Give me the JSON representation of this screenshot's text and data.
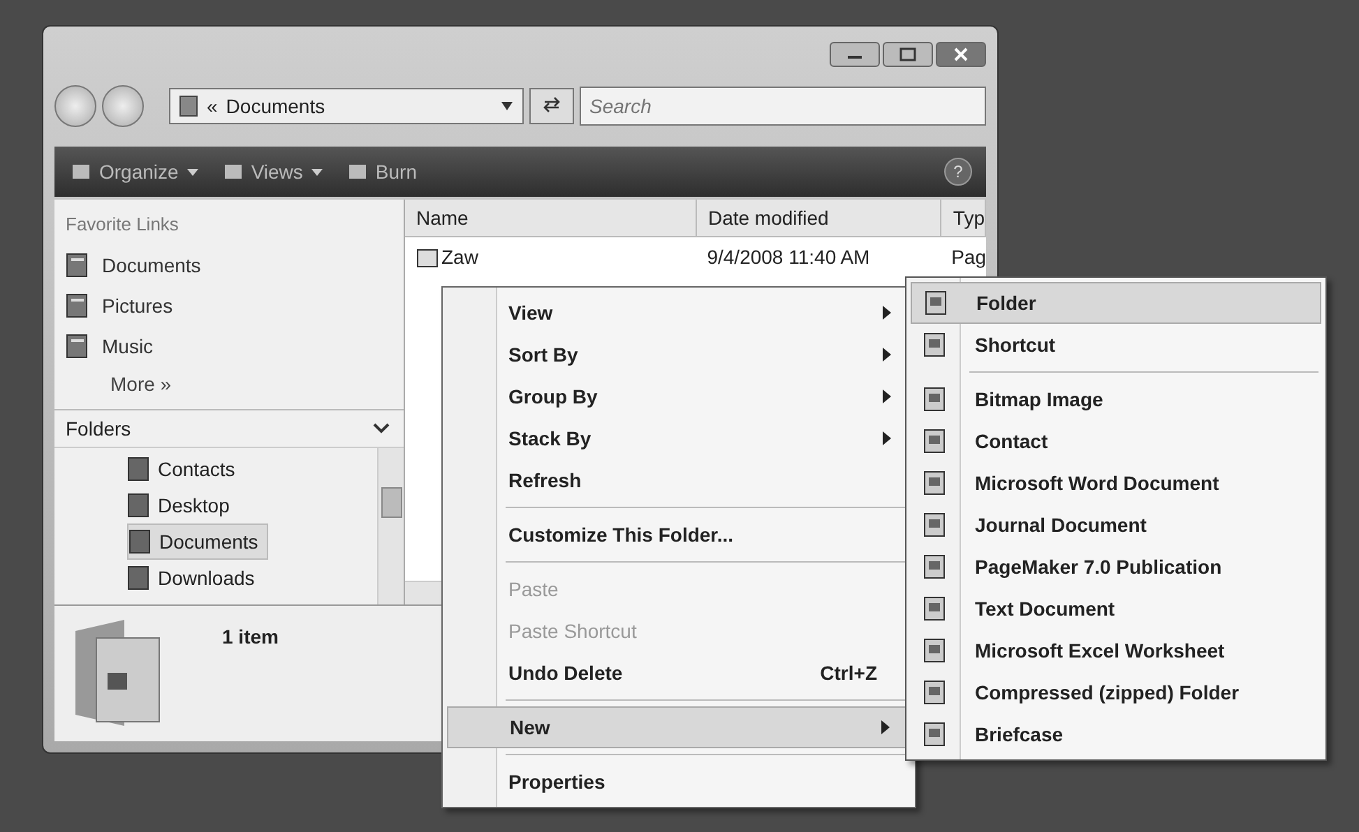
{
  "address_bar": {
    "prefix": "«",
    "location": "Documents"
  },
  "search": {
    "placeholder": "Search"
  },
  "toolbar": {
    "items": [
      {
        "label": "Organize",
        "has_menu": true
      },
      {
        "label": "Views",
        "has_menu": true
      },
      {
        "label": "Burn",
        "has_menu": false
      }
    ],
    "help": "?"
  },
  "nav": {
    "favorites_title": "Favorite Links",
    "favorites": [
      {
        "label": "Documents"
      },
      {
        "label": "Pictures"
      },
      {
        "label": "Music"
      }
    ],
    "more": "More »",
    "folders_title": "Folders",
    "folders": [
      {
        "label": "Contacts",
        "selected": false
      },
      {
        "label": "Desktop",
        "selected": false
      },
      {
        "label": "Documents",
        "selected": true
      },
      {
        "label": "Downloads",
        "selected": false
      }
    ]
  },
  "file_list": {
    "columns": [
      "Name",
      "Date modified",
      "Typ"
    ],
    "rows": [
      {
        "name": "Zaw",
        "date": "9/4/2008 11:40 AM",
        "type": "Pag"
      }
    ]
  },
  "details": {
    "count": "1 item"
  },
  "context_menu": {
    "groups": [
      [
        {
          "label": "View",
          "submenu": true,
          "disabled": false,
          "selected": false
        },
        {
          "label": "Sort By",
          "submenu": true,
          "disabled": false,
          "selected": false
        },
        {
          "label": "Group By",
          "submenu": true,
          "disabled": false,
          "selected": false
        },
        {
          "label": "Stack By",
          "submenu": true,
          "disabled": false,
          "selected": false
        },
        {
          "label": "Refresh",
          "submenu": false,
          "disabled": false,
          "selected": false
        }
      ],
      [
        {
          "label": "Customize This Folder...",
          "submenu": false,
          "disabled": false,
          "selected": false
        }
      ],
      [
        {
          "label": "Paste",
          "submenu": false,
          "disabled": true,
          "selected": false
        },
        {
          "label": "Paste Shortcut",
          "submenu": false,
          "disabled": true,
          "selected": false
        },
        {
          "label": "Undo Delete",
          "shortcut": "Ctrl+Z",
          "submenu": false,
          "disabled": false,
          "selected": false
        }
      ],
      [
        {
          "label": "New",
          "submenu": true,
          "disabled": false,
          "selected": true
        }
      ],
      [
        {
          "label": "Properties",
          "submenu": false,
          "disabled": false,
          "selected": false
        }
      ]
    ]
  },
  "new_submenu": {
    "groups": [
      [
        {
          "label": "Folder",
          "selected": true
        },
        {
          "label": "Shortcut",
          "selected": false
        }
      ],
      [
        {
          "label": "Bitmap Image",
          "selected": false
        },
        {
          "label": "Contact",
          "selected": false
        },
        {
          "label": "Microsoft Word Document",
          "selected": false
        },
        {
          "label": "Journal Document",
          "selected": false
        },
        {
          "label": "PageMaker 7.0 Publication",
          "selected": false
        },
        {
          "label": "Text Document",
          "selected": false
        },
        {
          "label": "Microsoft Excel Worksheet",
          "selected": false
        },
        {
          "label": "Compressed (zipped) Folder",
          "selected": false
        },
        {
          "label": "Briefcase",
          "selected": false
        }
      ]
    ]
  }
}
